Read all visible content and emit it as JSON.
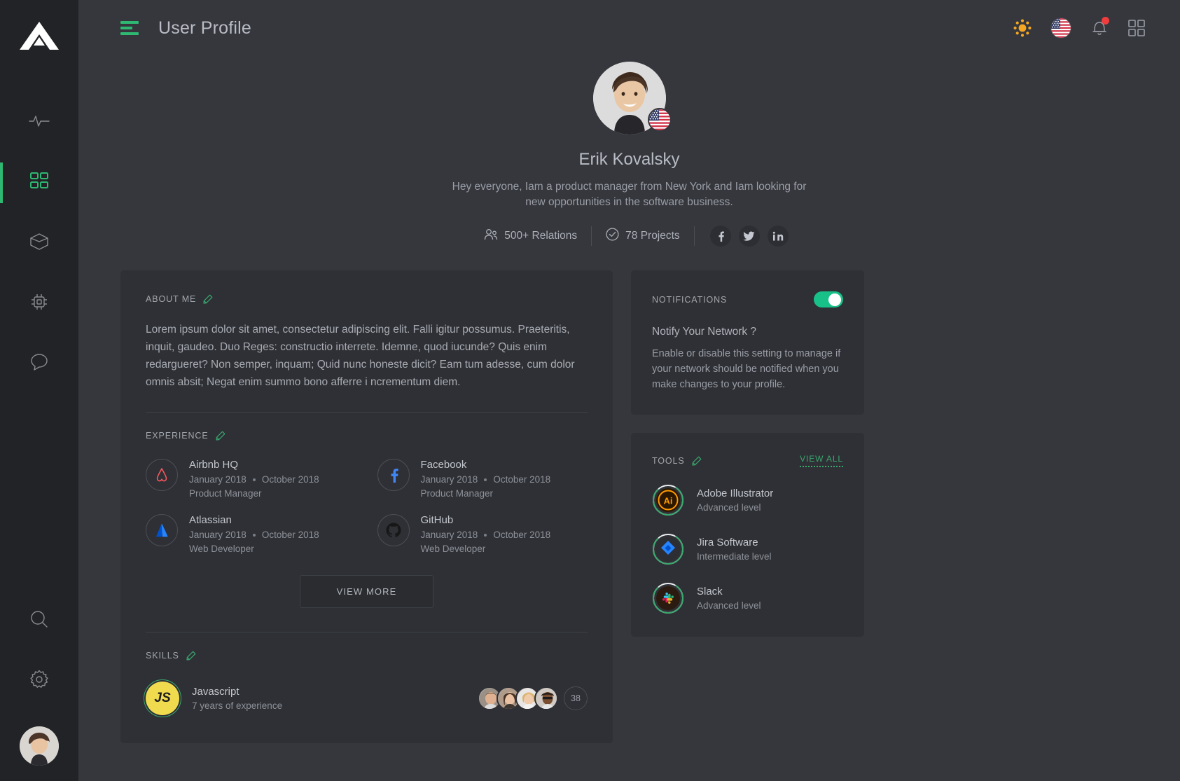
{
  "sidebar": {
    "logo_name": "triangle-logo",
    "items": [
      {
        "name": "activity",
        "icon": "pulse-icon",
        "active": false
      },
      {
        "name": "dashboard",
        "icon": "grid-icon",
        "active": true
      },
      {
        "name": "packages",
        "icon": "cube-icon",
        "active": false
      },
      {
        "name": "devices",
        "icon": "chip-icon",
        "active": false
      },
      {
        "name": "messages",
        "icon": "chat-bubble-icon",
        "active": false
      }
    ],
    "bottom_items": [
      {
        "name": "search",
        "icon": "search-icon"
      },
      {
        "name": "settings",
        "icon": "gear-icon"
      }
    ],
    "avatar_name": "user-avatar"
  },
  "topbar": {
    "menu_icon": "hamburger-icon",
    "title": "User Profile",
    "actions": [
      {
        "name": "theme-toggle",
        "icon": "sun-icon"
      },
      {
        "name": "language",
        "icon": "us-flag-icon"
      },
      {
        "name": "notifications",
        "icon": "bell-icon",
        "has_badge": true
      },
      {
        "name": "apps",
        "icon": "grid-apps-icon"
      }
    ]
  },
  "profile": {
    "name": "Erik Kovalsky",
    "bio": "Hey everyone,  Iam a product manager from New York and Iam looking for new opportunities in the software business.",
    "flag": "us-flag-icon",
    "stats": [
      {
        "icon": "users-icon",
        "label": "500+ Relations"
      },
      {
        "icon": "check-circle-icon",
        "label": "78 Projects"
      }
    ],
    "socials": [
      {
        "name": "facebook",
        "glyph": "f"
      },
      {
        "name": "twitter",
        "glyph": "t"
      },
      {
        "name": "linkedin",
        "glyph": "in"
      }
    ]
  },
  "about": {
    "title": "ABOUT ME",
    "edit_icon": "pencil-icon",
    "text": "Lorem ipsum dolor sit amet, consectetur adipiscing elit. Falli igitur possumus. Praeteritis, inquit, gaudeo. Duo Reges: constructio interrete. Idemne, quod iucunde? Quis enim redargueret? Non semper, inquam; Quid nunc honeste dicit? Eam tum adesse, cum dolor omnis absit; Negat enim summo bono afferre i ncrementum diem."
  },
  "experience": {
    "title": "EXPERIENCE",
    "edit_icon": "pencil-icon",
    "items": [
      {
        "company": "Airbnb HQ",
        "logo": "airbnb-logo",
        "start": "January 2018",
        "end": "October 2018",
        "role": "Product Manager"
      },
      {
        "company": "Facebook",
        "logo": "facebook-logo",
        "start": "January 2018",
        "end": "October 2018",
        "role": "Product Manager"
      },
      {
        "company": "Atlassian",
        "logo": "atlassian-logo",
        "start": "January 2018",
        "end": "October 2018",
        "role": "Web Developer"
      },
      {
        "company": "GitHub",
        "logo": "github-logo",
        "start": "January 2018",
        "end": "October 2018",
        "role": "Web Developer"
      }
    ],
    "view_more_label": "VIEW MORE"
  },
  "skills": {
    "title": "SKILLS",
    "edit_icon": "pencil-icon",
    "items": [
      {
        "badge": "JS",
        "name": "Javascript",
        "detail": "7 years of experience",
        "endorsers_count": "38",
        "endorser_avatars": 4
      }
    ]
  },
  "notifications": {
    "title": "NOTIFICATIONS",
    "toggle_on": true,
    "question": "Notify Your Network ?",
    "description": "Enable or disable this setting to manage if your network should be notified when you make changes to your profile."
  },
  "tools": {
    "title": "TOOLS",
    "edit_icon": "pencil-icon",
    "view_all_label": "VIEW ALL",
    "items": [
      {
        "name": "Adobe Illustrator",
        "level": "Advanced level",
        "icon": "adobe-illustrator-logo",
        "progress": 80
      },
      {
        "name": "Jira Software",
        "level": "Intermediate level",
        "icon": "jira-logo",
        "progress": 80
      },
      {
        "name": "Slack",
        "level": "Advanced level",
        "icon": "slack-logo",
        "progress": 80
      }
    ]
  },
  "colors": {
    "accent_green": "#2eb872",
    "toggle_green": "#18c187",
    "sidebar_bg": "#222326",
    "main_bg": "#35373d",
    "card_bg": "#2e3035",
    "badge_red": "#ef3d3d",
    "js_yellow": "#f0db4f"
  }
}
